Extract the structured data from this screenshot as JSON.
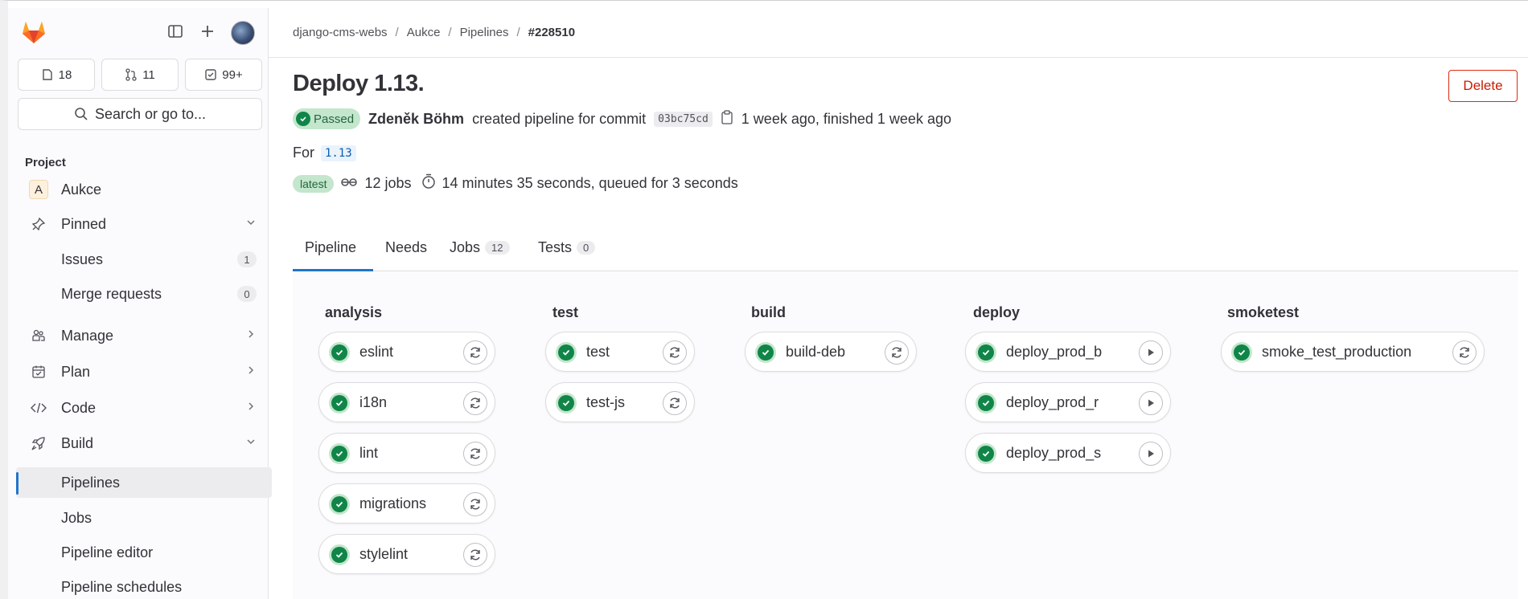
{
  "sidebar": {
    "counts": {
      "issues": "18",
      "merge_requests": "11",
      "todos": "99+"
    },
    "search": {
      "label": "Search or go to..."
    },
    "section_title": "Project",
    "project": {
      "letter": "A",
      "name": "Aukce"
    },
    "items": {
      "pinned": "Pinned",
      "issues": {
        "label": "Issues",
        "count": "1"
      },
      "merge_requests": {
        "label": "Merge requests",
        "count": "0"
      },
      "manage": "Manage",
      "plan": "Plan",
      "code": "Code",
      "build": "Build",
      "pipelines": "Pipelines",
      "jobs": "Jobs",
      "pipeline_editor": "Pipeline editor",
      "pipeline_schedules": "Pipeline schedules"
    }
  },
  "breadcrumb": [
    "django-cms-webs",
    "Aukce",
    "Pipelines",
    "#228510"
  ],
  "header": {
    "title": "Deploy 1.13.",
    "delete_label": "Delete",
    "status": "Passed",
    "author": "Zdeněk Böhm",
    "created_text": "created pipeline for commit",
    "commit": "03bc75cd",
    "time_text": "1 week ago, finished 1 week ago",
    "for_label": "For",
    "ref": "1.13",
    "latest_badge": "latest",
    "jobs_count": "12 jobs",
    "duration_text": "14 minutes 35 seconds, queued for 3 seconds"
  },
  "tabs": [
    {
      "label": "Pipeline"
    },
    {
      "label": "Needs"
    },
    {
      "label": "Jobs",
      "count": "12"
    },
    {
      "label": "Tests",
      "count": "0"
    }
  ],
  "stages": [
    {
      "name": "analysis",
      "jobs": [
        "eslint",
        "i18n",
        "lint",
        "migrations",
        "stylelint"
      ]
    },
    {
      "name": "test",
      "jobs": [
        "test",
        "test-js"
      ]
    },
    {
      "name": "build",
      "jobs": [
        "build-deb"
      ]
    },
    {
      "name": "deploy",
      "jobs": [
        "deploy_prod_b",
        "deploy_prod_r",
        "deploy_prod_s"
      ]
    },
    {
      "name": "smoketest",
      "jobs": [
        "smoke_test_production"
      ]
    }
  ],
  "colors": {
    "success": "#108548",
    "accent": "#1f75cb",
    "danger": "#dd2b0e"
  }
}
